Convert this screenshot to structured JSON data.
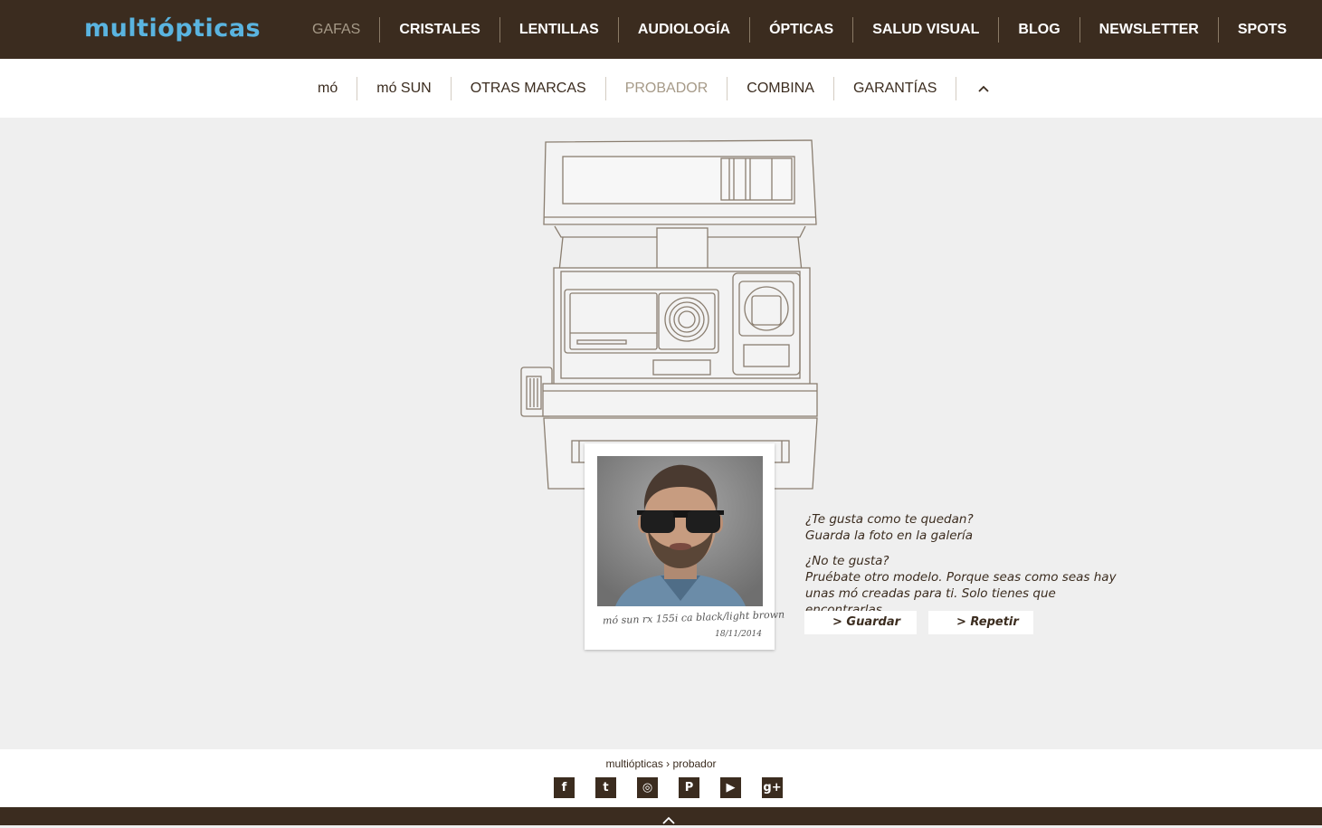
{
  "brand": {
    "logo": "multiópticas"
  },
  "main_nav": [
    {
      "label": "GAFAS",
      "active": true
    },
    {
      "label": "CRISTALES"
    },
    {
      "label": "LENTILLAS"
    },
    {
      "label": "AUDIOLOGÍA"
    },
    {
      "label": "ÓPTICAS"
    },
    {
      "label": "SALUD VISUAL"
    },
    {
      "label": "BLOG"
    },
    {
      "label": "NEWSLETTER"
    },
    {
      "label": "SPOTS"
    }
  ],
  "main_nav_icon": "heart-icon",
  "sub_nav": [
    {
      "label": "mó"
    },
    {
      "label": "mó SUN"
    },
    {
      "label": "OTRAS MARCAS"
    },
    {
      "label": "PROBADOR",
      "active": true
    },
    {
      "label": "COMBINA"
    },
    {
      "label": "GARANTÍAS"
    }
  ],
  "sub_nav_icon": "chevron-up-icon",
  "polaroid": {
    "caption": "mó sun rx 155i ca black/light brown",
    "date": "18/11/2014"
  },
  "message": {
    "q1": "¿Te gusta como te quedan?",
    "a1": "Guarda la foto en la galería",
    "q2": "¿No te gusta?",
    "a2_line1": "Pruébate otro modelo. Porque seas como seas hay",
    "a2_line2": "unas mó creadas para ti. Solo tienes que encontrarlas."
  },
  "buttons": {
    "save": "> Guardar",
    "repeat": "> Repetir"
  },
  "footer": {
    "breadcrumb": "multiópticas › probador",
    "social": [
      {
        "icon": "facebook-icon",
        "glyph": "f"
      },
      {
        "icon": "twitter-icon",
        "glyph": "t"
      },
      {
        "icon": "instagram-icon",
        "glyph": "◎"
      },
      {
        "icon": "pinterest-icon",
        "glyph": "P"
      },
      {
        "icon": "youtube-icon",
        "glyph": "▶"
      },
      {
        "icon": "googleplus-icon",
        "glyph": "g+"
      }
    ]
  },
  "colors": {
    "dark_brown": "#3b2c1f",
    "brand_blue": "#5ab4e0",
    "muted": "#a69a88",
    "background": "#efefef"
  }
}
